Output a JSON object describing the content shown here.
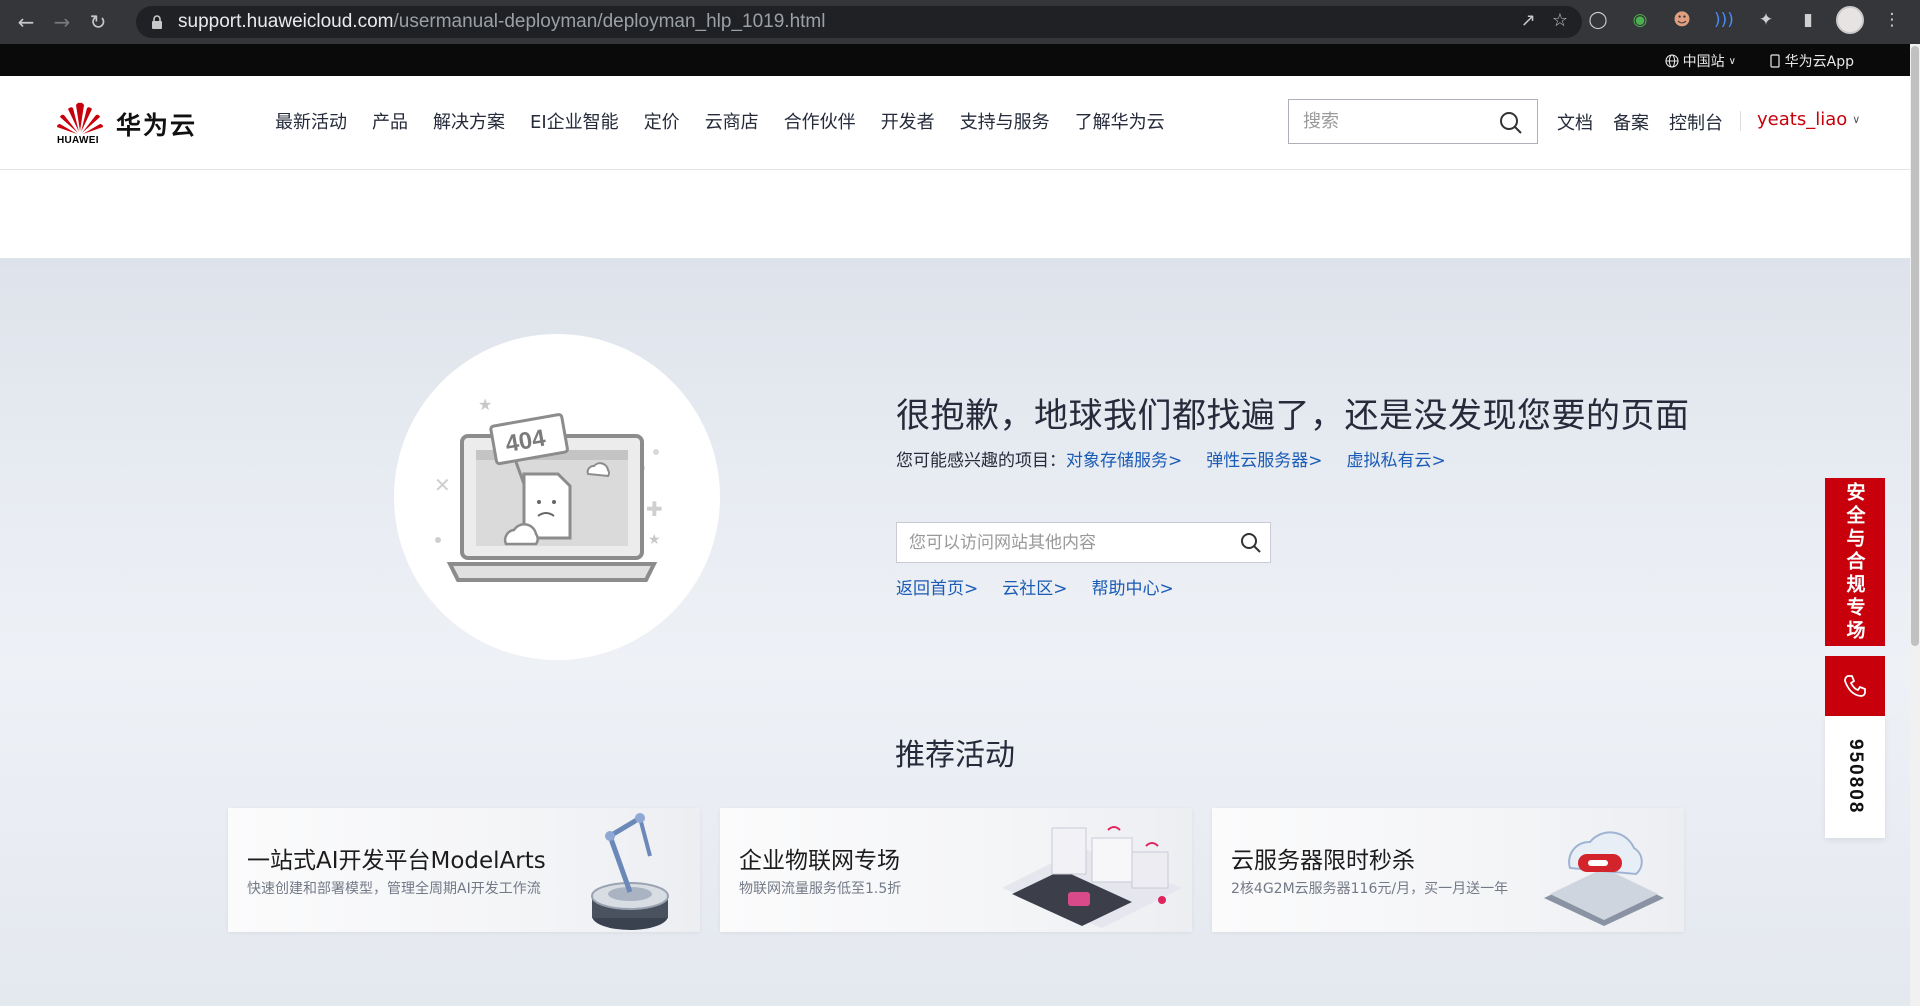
{
  "browser": {
    "url_host": "support.huaweicloud.com",
    "url_path": "/usermanual-deployman/deployman_hlp_1019.html"
  },
  "topbar": {
    "region_label": "中国站",
    "app_label": "华为云App"
  },
  "header": {
    "logo_text_en": "HUAWEI",
    "logo_text_cn": "华为云",
    "nav": [
      "最新活动",
      "产品",
      "解决方案",
      "EI企业智能",
      "定价",
      "云商店",
      "合作伙伴",
      "开发者",
      "支持与服务",
      "了解华为云"
    ],
    "search_placeholder": "搜索",
    "right_links": [
      "文档",
      "备案",
      "控制台"
    ],
    "username": "yeats_liao"
  },
  "error": {
    "illustration_code": "404",
    "title": "很抱歉，地球我们都找遍了，还是没发现您要的页面",
    "interest_label": "您可能感兴趣的项目：",
    "interest_links": [
      "对象存储服务>",
      "弹性云服务器>",
      "虚拟私有云>"
    ],
    "site_search_placeholder": "您可以访问网站其他内容",
    "quick_links": [
      "返回首页>",
      "云社区>",
      "帮助中心>"
    ]
  },
  "recommend": {
    "title": "推荐活动",
    "cards": [
      {
        "title": "一站式AI开发平台ModelArts",
        "subtitle": "快速创建和部署模型，管理全周期AI开发工作流"
      },
      {
        "title": "企业物联网专场",
        "subtitle": "物联网流量服务低至1.5折"
      },
      {
        "title": "云服务器限时秒杀",
        "subtitle": "2核4G2M云服务器116元/月，买一月送一年"
      }
    ]
  },
  "float_bar": {
    "compliance_label": "安全与合规专场",
    "phone_number": "950808"
  },
  "colors": {
    "brand_red": "#c7000b",
    "link_blue": "#1a5bb5"
  }
}
